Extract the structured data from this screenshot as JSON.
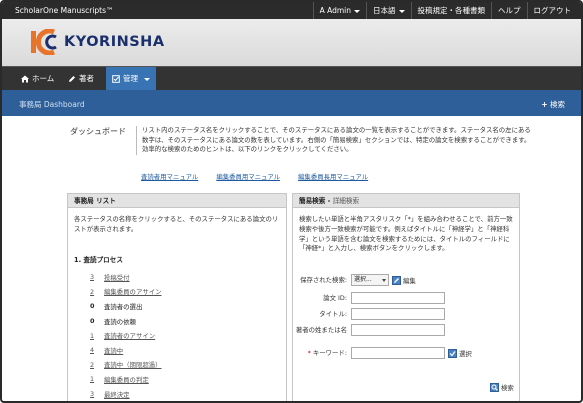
{
  "app": {
    "brand": "ScholarOne Manuscripts™",
    "logo_text": "KYORINSHA"
  },
  "topnav": {
    "user": "A Admin",
    "language": "日本語",
    "guidelines": "投稿規定・各種書類",
    "help": "ヘルプ",
    "logout": "ログアウト"
  },
  "mainnav": {
    "home": "ホーム",
    "author": "著者",
    "admin": "管理"
  },
  "dashbar": {
    "title": "事務局 Dashboard",
    "search": "検索"
  },
  "intro": {
    "label": "ダッシュボード",
    "text": "リスト内のステータス名をクリックすることで、そのステータスにある論文の一覧を表示することができます。ステータス名の左にある数字は、そのステータスにある論文の数を表しています。右側の「簡易検索」セクションでは、特定の論文を検索することができます。効率的な検索のためのヒントは、以下のリンクをクリックしてください。",
    "links": [
      "査読者用マニュアル",
      "編集委員用マニュアル",
      "編集委員長用マニュアル"
    ]
  },
  "left_panel": {
    "title": "事務局 リスト",
    "description": "各ステータスの名称をクリックすると、そのステータスにある論文のリストが表示されます。",
    "section": "1. 査読プロセス",
    "rows": [
      {
        "count": "3",
        "label": "投稿受付"
      },
      {
        "count": "2",
        "label": "編集委員のアサイン"
      },
      {
        "count": "0",
        "label": "査読者の選出"
      },
      {
        "count": "0",
        "label": "査読の依頼"
      },
      {
        "count": "1",
        "label": "査読者のアサイン"
      },
      {
        "count": "4",
        "label": "査読中"
      },
      {
        "count": "2",
        "label": "査読中（期限超過）"
      },
      {
        "count": "1",
        "label": "編集委員の判定"
      },
      {
        "count": "3",
        "label": "最終決定"
      }
    ]
  },
  "right_panel": {
    "title": "簡易検索",
    "subtitle": "詳細検索",
    "description": "検索したい単語と半角アスタリスク「*」を組み合わせることで、前方一致検索や後方一致検索が可能です。例えばタイトルに「神経学」と「神経科学」という単語を含む論文を検索するためには、タイトルのフィールドに「神経*」と入力し、検索ボタンをクリックします。",
    "saved_search_label": "保存された検索:",
    "saved_search_value": "選択...",
    "edit": "編集",
    "manuscript_id_label": "論文 ID:",
    "title_label": "タイトル:",
    "author_label": "著者の姓または名",
    "keyword_label": "キーワード:",
    "select": "選択",
    "search_button": "検索"
  },
  "colors": {
    "topbar": "#2b2b2b",
    "mainnav": "#333333",
    "active_tab": "#3873b4",
    "dashbar": "#2f5f99",
    "link": "#1f5aa0",
    "logo_orange": "#e8742a",
    "logo_blue": "#1a2f6b"
  }
}
